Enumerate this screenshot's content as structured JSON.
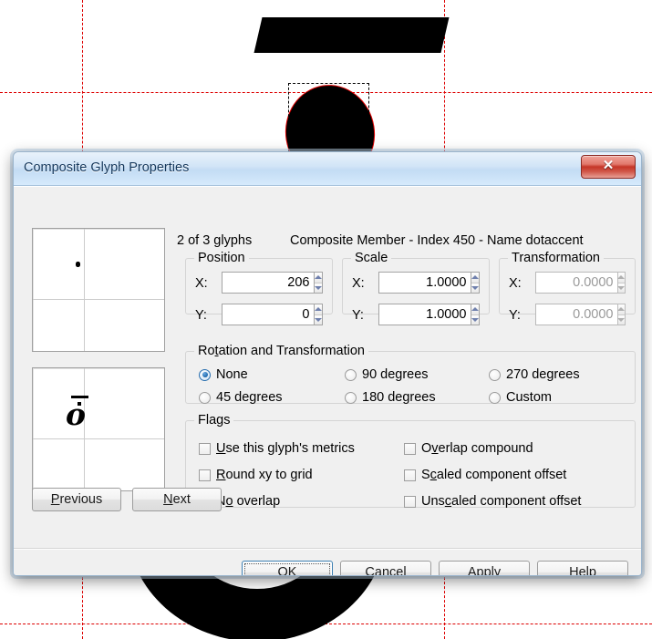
{
  "background": {
    "name": "glyph-editor-canvas",
    "guides": {
      "color": "#dd0000",
      "style": "dashed"
    },
    "shapes": [
      "macron-outline",
      "dotaccent-selected-ellipse",
      "o-glyph-outline"
    ]
  },
  "dialog": {
    "title": "Composite Glyph Properties",
    "close_label": "✕",
    "header": {
      "glyph_count": "2 of 3 glyphs",
      "member_info": "Composite Member - Index 450 - Name dotaccent"
    },
    "groups": {
      "position": "Position",
      "scale": "Scale",
      "transformation": "Transformation",
      "rotation": "Rotation and Transformation",
      "flags": "Flags"
    },
    "fields": {
      "position_x_label": "X:",
      "position_x_value": "206",
      "position_y_label": "Y:",
      "position_y_value": "0",
      "scale_x_label": "X:",
      "scale_x_value": "1.0000",
      "scale_y_label": "Y:",
      "scale_y_value": "1.0000",
      "transform_x_label": "X:",
      "transform_x_value": "0.0000",
      "transform_y_label": "Y:",
      "transform_y_value": "0.0000"
    },
    "rotation_options": [
      {
        "label": "None",
        "checked": true
      },
      {
        "label": "90 degrees",
        "checked": false
      },
      {
        "label": "270 degrees",
        "checked": false
      },
      {
        "label": "45 degrees",
        "checked": false
      },
      {
        "label": "180 degrees",
        "checked": false
      },
      {
        "label": "Custom",
        "checked": false
      }
    ],
    "flags": [
      {
        "label": "Use this glyph's metrics",
        "checked": false
      },
      {
        "label": "Round xy to grid",
        "checked": false
      },
      {
        "label": "No overlap",
        "checked": false
      },
      {
        "label": "Overlap compound",
        "checked": false
      },
      {
        "label": "Scaled component offset",
        "checked": false
      },
      {
        "label": "Unscaled component offset",
        "checked": false
      }
    ],
    "nav_buttons": {
      "previous": "Previous",
      "next": "Next"
    },
    "action_buttons": {
      "ok": "OK",
      "cancel": "Cancel",
      "apply": "Apply",
      "help": "Help"
    },
    "previews": {
      "top_caption": "dotaccent-component-preview",
      "bottom_caption": "composite-glyph-preview",
      "bottom_glyph": "o"
    }
  }
}
